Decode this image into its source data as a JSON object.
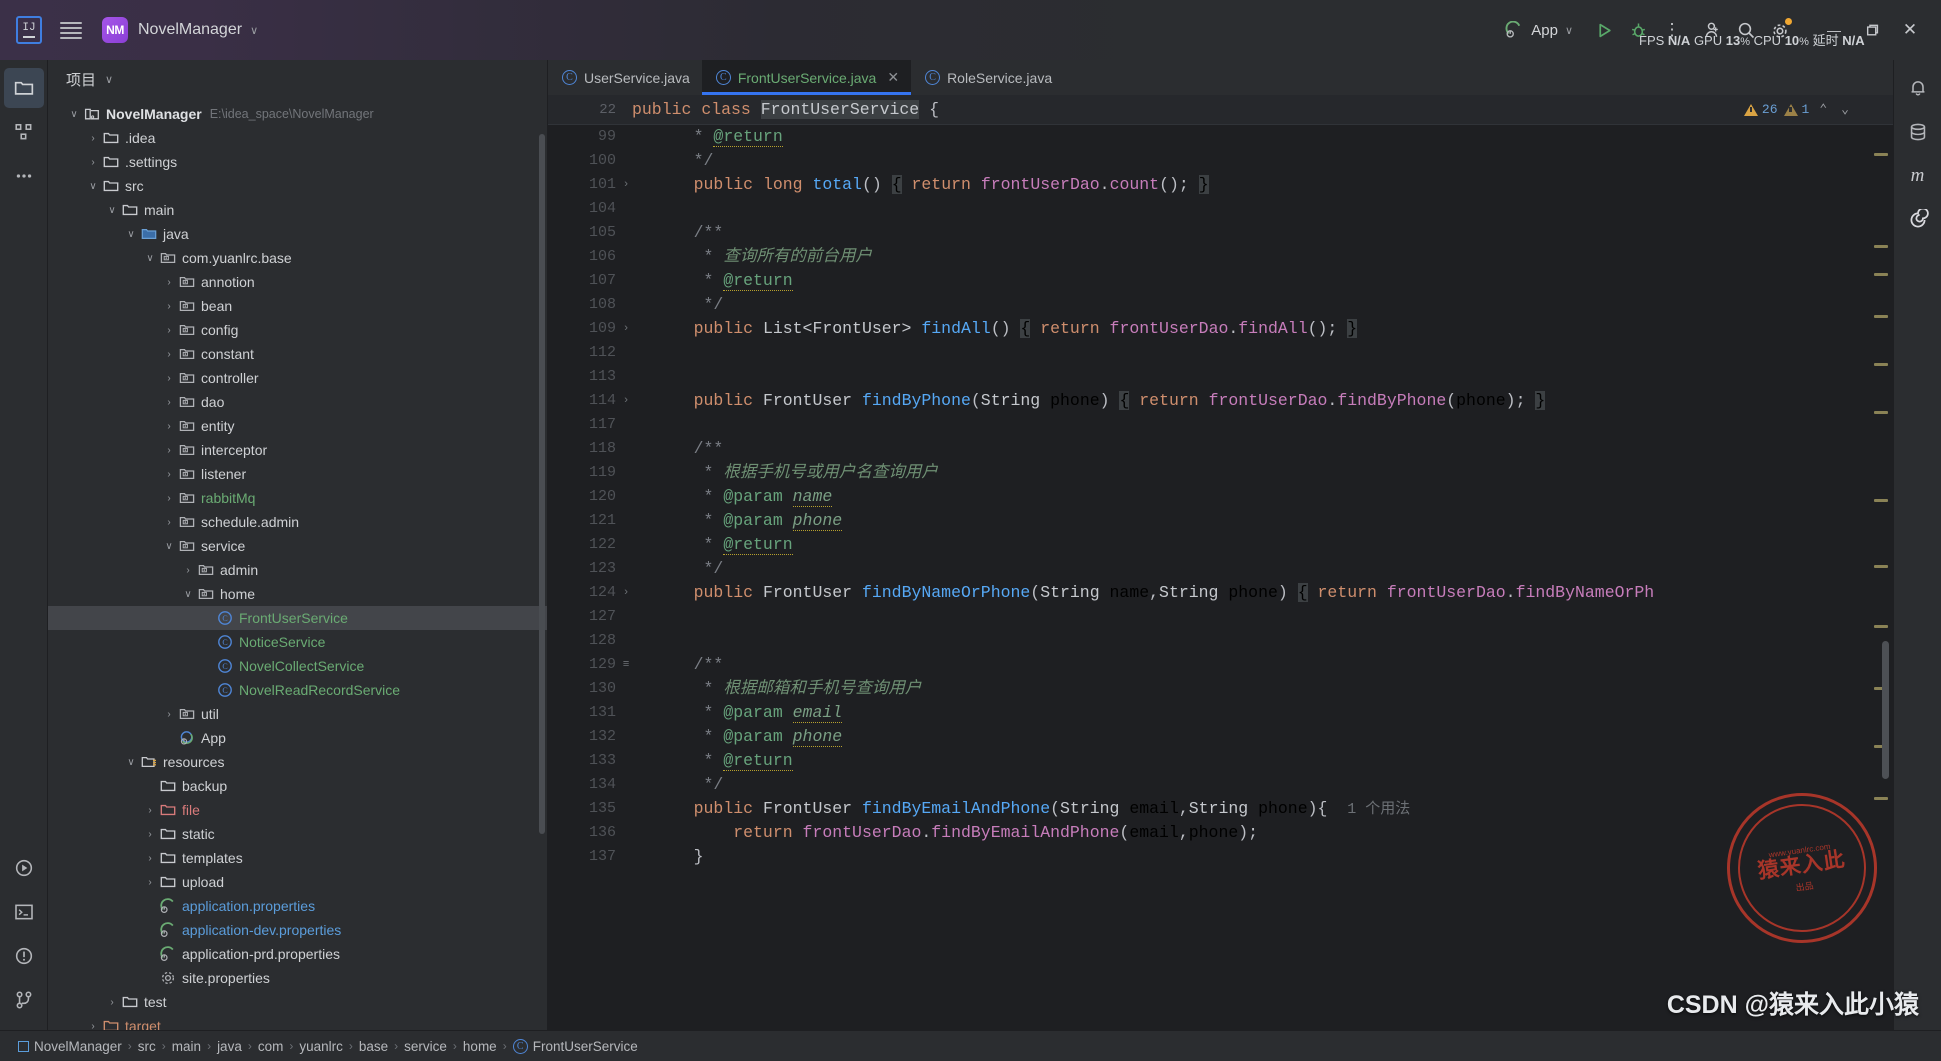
{
  "titlebar": {
    "ide_icon": "IJ",
    "menu_icon": "hamburger-icon",
    "project_badge": "NM",
    "project_name": "NovelManager",
    "project_caret": "∨",
    "run_config": "App",
    "run_caret": "∨",
    "run_button": "▷",
    "debug_button": "debug-icon",
    "more_button": "⋮",
    "perf": {
      "fps_label": "FPS",
      "fps_value": "N/A",
      "gpu_label": "GPU",
      "gpu_value": "13",
      "gpu_unit": "%",
      "cpu_label": "CPU",
      "cpu_value": "10",
      "cpu_unit": "%",
      "lat_label": "延时",
      "lat_value": "N/A"
    },
    "account_icon": "user-add-icon",
    "search_icon": "search-icon",
    "settings_icon": "gear-icon",
    "minimize": "—",
    "maximize": "❐",
    "close": "✕"
  },
  "activitybar": {
    "items": [
      {
        "name": "project-tool-window",
        "icon": "folder-icon",
        "active": true
      },
      {
        "name": "structure-tool-window",
        "icon": "structure-icon",
        "active": false
      },
      {
        "name": "more-tool-windows",
        "icon": "ellipsis-icon",
        "active": false
      }
    ],
    "bottom_items": [
      {
        "name": "run-tool-window",
        "icon": "play-circle-icon"
      },
      {
        "name": "terminal-tool-window",
        "icon": "terminal-icon"
      },
      {
        "name": "problems-tool-window",
        "icon": "warning-circle-icon"
      },
      {
        "name": "version-control-tool-window",
        "icon": "branch-icon"
      }
    ]
  },
  "project_panel": {
    "title": "项目",
    "title_caret": "∨",
    "tree": [
      {
        "depth": 0,
        "arrow": "∨",
        "icon": "module-icon",
        "label": "NovelManager",
        "bold": true,
        "sub": "E:\\idea_space\\NovelManager"
      },
      {
        "depth": 1,
        "arrow": "›",
        "icon": "folder-icon",
        "label": ".idea"
      },
      {
        "depth": 1,
        "arrow": "›",
        "icon": "folder-icon",
        "label": ".settings"
      },
      {
        "depth": 1,
        "arrow": "∨",
        "icon": "folder-icon",
        "label": "src"
      },
      {
        "depth": 2,
        "arrow": "∨",
        "icon": "folder-icon",
        "label": "main"
      },
      {
        "depth": 3,
        "arrow": "∨",
        "icon": "source-folder-icon",
        "label": "java"
      },
      {
        "depth": 4,
        "arrow": "∨",
        "icon": "package-icon",
        "label": "com.yuanlrc.base"
      },
      {
        "depth": 5,
        "arrow": "›",
        "icon": "package-icon",
        "label": "annotion"
      },
      {
        "depth": 5,
        "arrow": "›",
        "icon": "package-icon",
        "label": "bean"
      },
      {
        "depth": 5,
        "arrow": "›",
        "icon": "package-icon",
        "label": "config"
      },
      {
        "depth": 5,
        "arrow": "›",
        "icon": "package-icon",
        "label": "constant"
      },
      {
        "depth": 5,
        "arrow": "›",
        "icon": "package-icon",
        "label": "controller"
      },
      {
        "depth": 5,
        "arrow": "›",
        "icon": "package-icon",
        "label": "dao"
      },
      {
        "depth": 5,
        "arrow": "›",
        "icon": "package-icon",
        "label": "entity"
      },
      {
        "depth": 5,
        "arrow": "›",
        "icon": "package-icon",
        "label": "interceptor"
      },
      {
        "depth": 5,
        "arrow": "›",
        "icon": "package-icon",
        "label": "listener"
      },
      {
        "depth": 5,
        "arrow": "›",
        "icon": "package-icon",
        "label": "rabbitMq",
        "color": "green"
      },
      {
        "depth": 5,
        "arrow": "›",
        "icon": "package-icon",
        "label": "schedule.admin"
      },
      {
        "depth": 5,
        "arrow": "∨",
        "icon": "package-icon",
        "label": "service"
      },
      {
        "depth": 6,
        "arrow": "›",
        "icon": "package-icon",
        "label": "admin"
      },
      {
        "depth": 6,
        "arrow": "∨",
        "icon": "package-icon",
        "label": "home"
      },
      {
        "depth": 7,
        "arrow": "",
        "icon": "class-icon",
        "label": "FrontUserService",
        "color": "green",
        "selected": true
      },
      {
        "depth": 7,
        "arrow": "",
        "icon": "class-icon",
        "label": "NoticeService",
        "color": "green"
      },
      {
        "depth": 7,
        "arrow": "",
        "icon": "class-icon",
        "label": "NovelCollectService",
        "color": "green"
      },
      {
        "depth": 7,
        "arrow": "",
        "icon": "class-icon",
        "label": "NovelReadRecordService",
        "color": "green"
      },
      {
        "depth": 5,
        "arrow": "›",
        "icon": "package-icon",
        "label": "util"
      },
      {
        "depth": 5,
        "arrow": "",
        "icon": "spring-class-icon",
        "label": "App"
      },
      {
        "depth": 3,
        "arrow": "∨",
        "icon": "resource-folder-icon",
        "label": "resources"
      },
      {
        "depth": 4,
        "arrow": "",
        "icon": "folder-icon",
        "label": "backup"
      },
      {
        "depth": 4,
        "arrow": "›",
        "icon": "folder-icon",
        "label": "file",
        "color": "red"
      },
      {
        "depth": 4,
        "arrow": "›",
        "icon": "folder-icon",
        "label": "static"
      },
      {
        "depth": 4,
        "arrow": "›",
        "icon": "folder-icon",
        "label": "templates"
      },
      {
        "depth": 4,
        "arrow": "›",
        "icon": "folder-icon",
        "label": "upload"
      },
      {
        "depth": 4,
        "arrow": "",
        "icon": "spring-properties-icon",
        "label": "application.properties",
        "color": "blue"
      },
      {
        "depth": 4,
        "arrow": "",
        "icon": "spring-properties-icon",
        "label": "application-dev.properties",
        "color": "blue"
      },
      {
        "depth": 4,
        "arrow": "",
        "icon": "spring-properties-icon",
        "label": "application-prd.properties"
      },
      {
        "depth": 4,
        "arrow": "",
        "icon": "properties-icon",
        "label": "site.properties"
      },
      {
        "depth": 2,
        "arrow": "›",
        "icon": "folder-icon",
        "label": "test"
      },
      {
        "depth": 1,
        "arrow": "›",
        "icon": "folder-icon",
        "label": "target",
        "color": "orange"
      }
    ]
  },
  "editor": {
    "tabs": [
      {
        "name": "tab-userservice",
        "label": "UserService.java",
        "icon": "class-icon",
        "active": false,
        "closable": false
      },
      {
        "name": "tab-frontuserservice",
        "label": "FrontUserService.java",
        "icon": "class-icon",
        "active": true,
        "closable": true,
        "close": "✕"
      },
      {
        "name": "tab-roleservice",
        "label": "RoleService.java",
        "icon": "class-icon",
        "active": false,
        "closable": false
      }
    ],
    "sticky_header": {
      "line": "22",
      "code": "public class FrontUserService {"
    },
    "inspections": {
      "warnings": "26",
      "weak_warnings": "1",
      "up": "⌃",
      "down": "⌄"
    },
    "lines": [
      {
        "num": "99",
        "fold": "",
        "html": "    <span class='cmt'>* </span><span class='tagu'>@return</span>"
      },
      {
        "num": "100",
        "fold": "",
        "html": "    <span class='cmt'>*/</span>"
      },
      {
        "num": "101",
        "fold": "›",
        "html": "    <span class='kw'>public</span> <span class='kw'>long</span> <span class='mth'>total</span><span class='punc'>()</span> <span class='brace-hl'>{</span> <span class='kw'>return</span> <span class='fld'>frontUserDao</span><span class='punc'>.</span><span class='fld'>count</span><span class='punc'>();</span> <span class='brace-hl'>}</span>"
      },
      {
        "num": "104",
        "fold": "",
        "html": ""
      },
      {
        "num": "105",
        "fold": "",
        "html": "    <span class='cmt'>/**</span>"
      },
      {
        "num": "106",
        "fold": "",
        "html": "     <span class='cmt'>* </span><span class='cmtit'>查询所有的前台用户</span>"
      },
      {
        "num": "107",
        "fold": "",
        "html": "     <span class='cmt'>* </span><span class='tagu'>@return</span>"
      },
      {
        "num": "108",
        "fold": "",
        "html": "     <span class='cmt'>*/</span>"
      },
      {
        "num": "109",
        "fold": "›",
        "html": "    <span class='kw'>public</span> <span class='type'>List&lt;FrontUser&gt;</span> <span class='mth'>findAll</span><span class='punc'>()</span> <span class='brace-hl'>{</span> <span class='kw'>return</span> <span class='fld'>frontUserDao</span><span class='punc'>.</span><span class='fld'>findAll</span><span class='punc'>();</span> <span class='brace-hl'>}</span>"
      },
      {
        "num": "112",
        "fold": "",
        "html": ""
      },
      {
        "num": "113",
        "fold": "",
        "html": ""
      },
      {
        "num": "114",
        "fold": "›",
        "html": "    <span class='kw'>public</span> <span class='type'>FrontUser</span> <span class='mth'>findByPhone</span><span class='punc'>(</span><span class='type'>String</span> phone<span class='punc'>)</span> <span class='brace-hl'>{</span> <span class='kw'>return</span> <span class='fld'>frontUserDao</span><span class='punc'>.</span><span class='fld'>findByPhone</span><span class='punc'>(</span>phone<span class='punc'>);</span> <span class='brace-hl'>}</span>"
      },
      {
        "num": "117",
        "fold": "",
        "html": ""
      },
      {
        "num": "118",
        "fold": "",
        "html": "    <span class='cmt'>/**</span>"
      },
      {
        "num": "119",
        "fold": "",
        "html": "     <span class='cmt'>* </span><span class='cmtit'>根据手机号或用户名查询用户</span>"
      },
      {
        "num": "120",
        "fold": "",
        "html": "     <span class='cmt'>* </span><span class='tag'>@param</span> <span class='param'>name</span>"
      },
      {
        "num": "121",
        "fold": "",
        "html": "     <span class='cmt'>* </span><span class='tag'>@param</span> <span class='param'>phone</span>"
      },
      {
        "num": "122",
        "fold": "",
        "html": "     <span class='cmt'>* </span><span class='tagu'>@return</span>"
      },
      {
        "num": "123",
        "fold": "",
        "html": "     <span class='cmt'>*/</span>"
      },
      {
        "num": "124",
        "fold": "›",
        "html": "    <span class='kw'>public</span> <span class='type'>FrontUser</span> <span class='mth'>findByNameOrPhone</span><span class='punc'>(</span><span class='type'>String</span> name<span class='punc'>,</span><span class='type'>String</span> phone<span class='punc'>)</span> <span class='brace-hl'>{</span> <span class='kw'>return</span> <span class='fld'>frontUserDao</span><span class='punc'>.</span><span class='fld'>findByNameOrPh</span>"
      },
      {
        "num": "127",
        "fold": "",
        "html": ""
      },
      {
        "num": "128",
        "fold": "",
        "html": ""
      },
      {
        "num": "129",
        "fold": "≡",
        "html": "    <span class='cmt'>/**</span>"
      },
      {
        "num": "130",
        "fold": "",
        "html": "     <span class='cmt'>* </span><span class='cmtit'>根据邮箱和手机号查询用户</span>"
      },
      {
        "num": "131",
        "fold": "",
        "html": "     <span class='cmt'>* </span><span class='tag'>@param</span> <span class='param'>email</span>"
      },
      {
        "num": "132",
        "fold": "",
        "html": "     <span class='cmt'>* </span><span class='tag'>@param</span> <span class='param'>phone</span>"
      },
      {
        "num": "133",
        "fold": "",
        "html": "     <span class='cmt'>* </span><span class='tagu'>@return</span>"
      },
      {
        "num": "134",
        "fold": "",
        "html": "     <span class='cmt'>*/</span>"
      },
      {
        "num": "135",
        "fold": "",
        "html": "    <span class='kw'>public</span> <span class='type'>FrontUser</span> <span class='mth'>findByEmailAndPhone</span><span class='punc'>(</span><span class='type'>String</span> email<span class='punc'>,</span><span class='type'>String</span> phone<span class='punc'>){</span>  <span class='usage'>1 个用法</span>"
      },
      {
        "num": "136",
        "fold": "",
        "html": "        <span class='kw'>return</span> <span class='fld'>frontUserDao</span><span class='punc'>.</span><span class='fld'>findByEmailAndPhone</span><span class='punc'>(</span>email<span class='punc'>,</span>phone<span class='punc'>);</span>"
      },
      {
        "num": "137",
        "fold": "",
        "html": "    <span class='punc'>}</span>"
      }
    ]
  },
  "right_tools": {
    "items": [
      {
        "name": "notifications-tool-window",
        "icon": "bell-icon"
      },
      {
        "name": "database-tool-window",
        "icon": "database-icon"
      },
      {
        "name": "maven-tool-window",
        "icon": "m-letter-icon"
      },
      {
        "name": "ai-assistant-tool-window",
        "icon": "spiral-icon"
      }
    ]
  },
  "statusbar": {
    "breadcrumb": [
      {
        "label": "NovelManager",
        "icon": "module-icon"
      },
      {
        "label": "src",
        "icon": ""
      },
      {
        "label": "main",
        "icon": ""
      },
      {
        "label": "java",
        "icon": ""
      },
      {
        "label": "com",
        "icon": ""
      },
      {
        "label": "yuanlrc",
        "icon": ""
      },
      {
        "label": "base",
        "icon": ""
      },
      {
        "label": "service",
        "icon": ""
      },
      {
        "label": "home",
        "icon": ""
      },
      {
        "label": "FrontUserService",
        "icon": "class-icon"
      }
    ],
    "separator": "›"
  },
  "watermark": {
    "stamp_big": "猿来入此",
    "stamp_top": "www.yuanlrc.com",
    "stamp_bottom": "出品",
    "csdn_text": "CSDN @猿来入此小猿"
  },
  "colors": {
    "accent_blue": "#3574f0",
    "class_green": "#6aab73",
    "warn_yellow": "#d9a343",
    "keyword_orange": "#cf8e6d",
    "method_blue": "#56a8f5",
    "field_purple": "#c77dbb"
  }
}
